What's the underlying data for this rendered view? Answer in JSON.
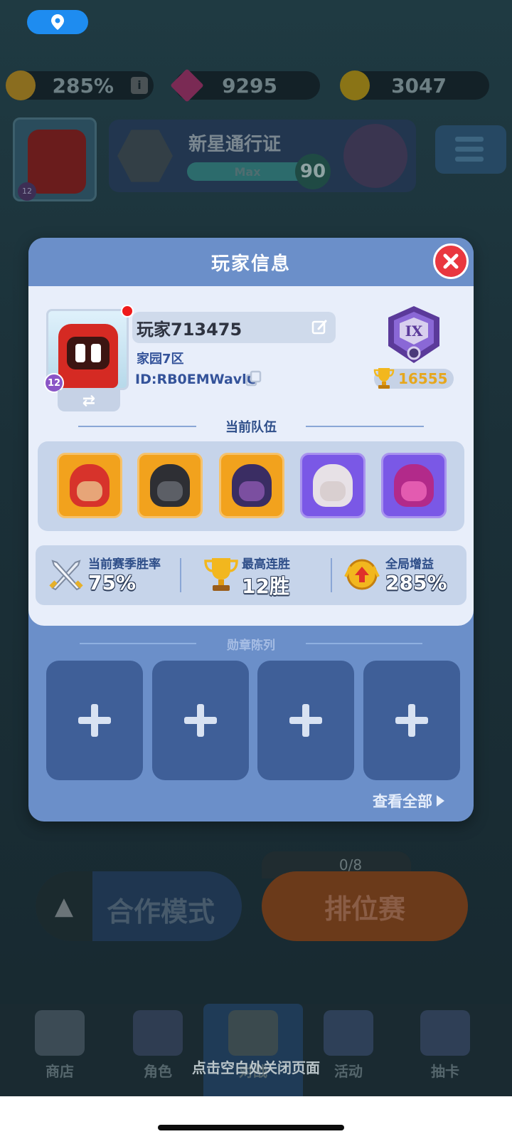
{
  "hud": {
    "boost": "285%",
    "gems": "9295",
    "coins": "3047",
    "avatar_level": "12"
  },
  "pass": {
    "title": "新星通行证",
    "bar_label": "Max",
    "level": "90"
  },
  "dialog": {
    "title": "玩家信息",
    "player_name": "玩家713475",
    "region": "家园7区",
    "player_id": "ID:RB0EMWavlC",
    "level": "12",
    "rank_tier": "IX",
    "trophies": "16555",
    "team_section_title": "当前队伍",
    "heroes": [
      {
        "name": "hero-1",
        "frame": "#f2a21d",
        "skin": "#e7a578",
        "hair": "#d7332b"
      },
      {
        "name": "hero-2",
        "frame": "#f2a21d",
        "skin": "#5c5f66",
        "hair": "#2e2f34"
      },
      {
        "name": "hero-3",
        "frame": "#f2a21d",
        "skin": "#7b4fa0",
        "hair": "#3a2d63"
      },
      {
        "name": "hero-4",
        "frame": "#7a58e6",
        "skin": "#d9cfd0",
        "hair": "#e7e1e6"
      },
      {
        "name": "hero-5",
        "frame": "#7a58e6",
        "skin": "#e35bb0",
        "hair": "#b22a8a"
      }
    ],
    "stats": {
      "win_rate_label": "当前赛季胜率",
      "win_rate_value": "75%",
      "streak_label": "最高连胜",
      "streak_value": "12胜",
      "boost_label": "全局增益",
      "boost_value": "285%"
    },
    "medal_section_title": "勋章陈列",
    "medal_slots": 4,
    "view_all": "查看全部"
  },
  "background": {
    "coop_mode": "合作模式",
    "ranked": "排位赛",
    "ranked_progress": "0/8"
  },
  "nav": {
    "items": [
      "商店",
      "角色",
      "对战",
      "活动",
      "抽卡"
    ]
  },
  "close_hint": "点击空白处关闭页面",
  "colors": {
    "dialog_header": "#6b8fc9",
    "panel": "#e8eefa",
    "close": "#e9373f",
    "slot": "#3f5f98",
    "trophy": "#e6a71e"
  }
}
